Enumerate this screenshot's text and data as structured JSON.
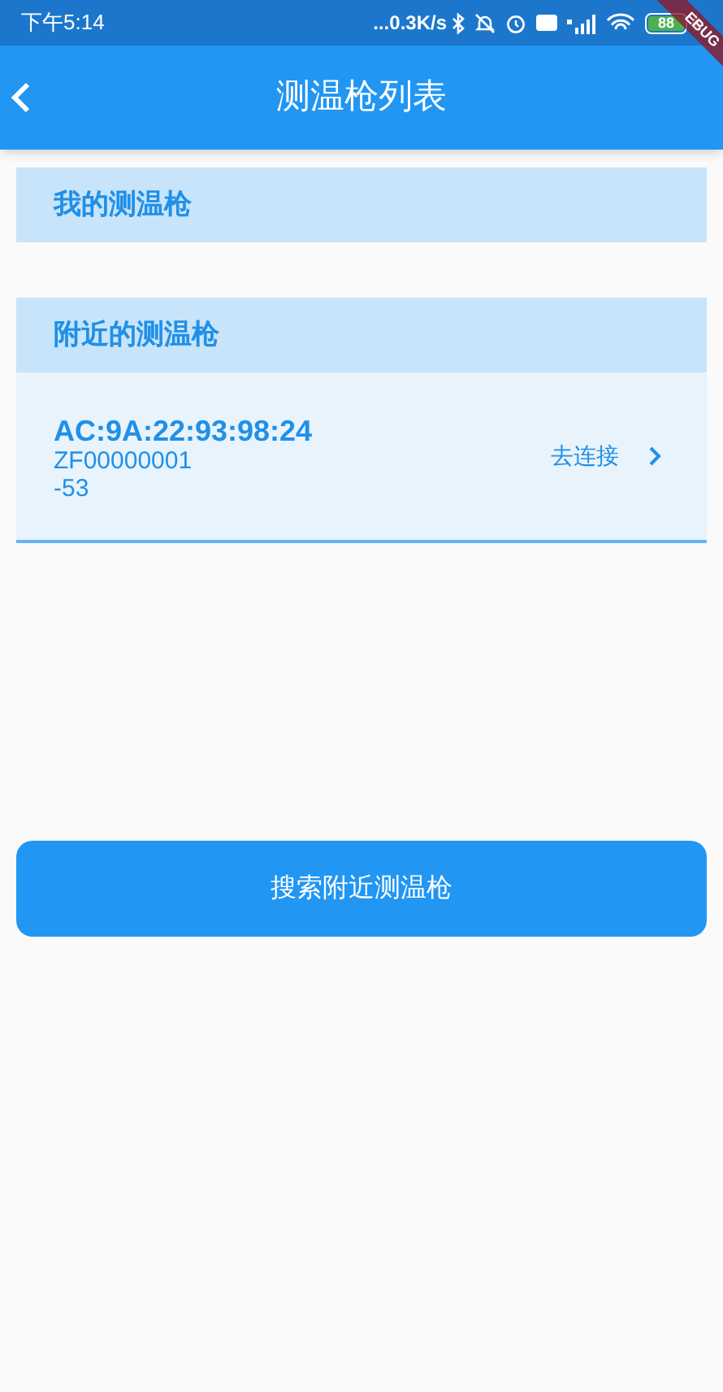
{
  "status_bar": {
    "time": "下午5:14",
    "network_speed": "...0.3K/s",
    "battery": "88"
  },
  "debug_banner": "EBUG",
  "app_bar": {
    "title": "测温枪列表"
  },
  "sections": [
    {
      "title": "我的测温枪"
    },
    {
      "title": "附近的测温枪",
      "devices": [
        {
          "address": "AC:9A:22:93:98:24",
          "serial": "ZF00000001",
          "rssi": "-53",
          "action": "去连接"
        }
      ]
    }
  ],
  "search_button": "搜索附近测温枪"
}
